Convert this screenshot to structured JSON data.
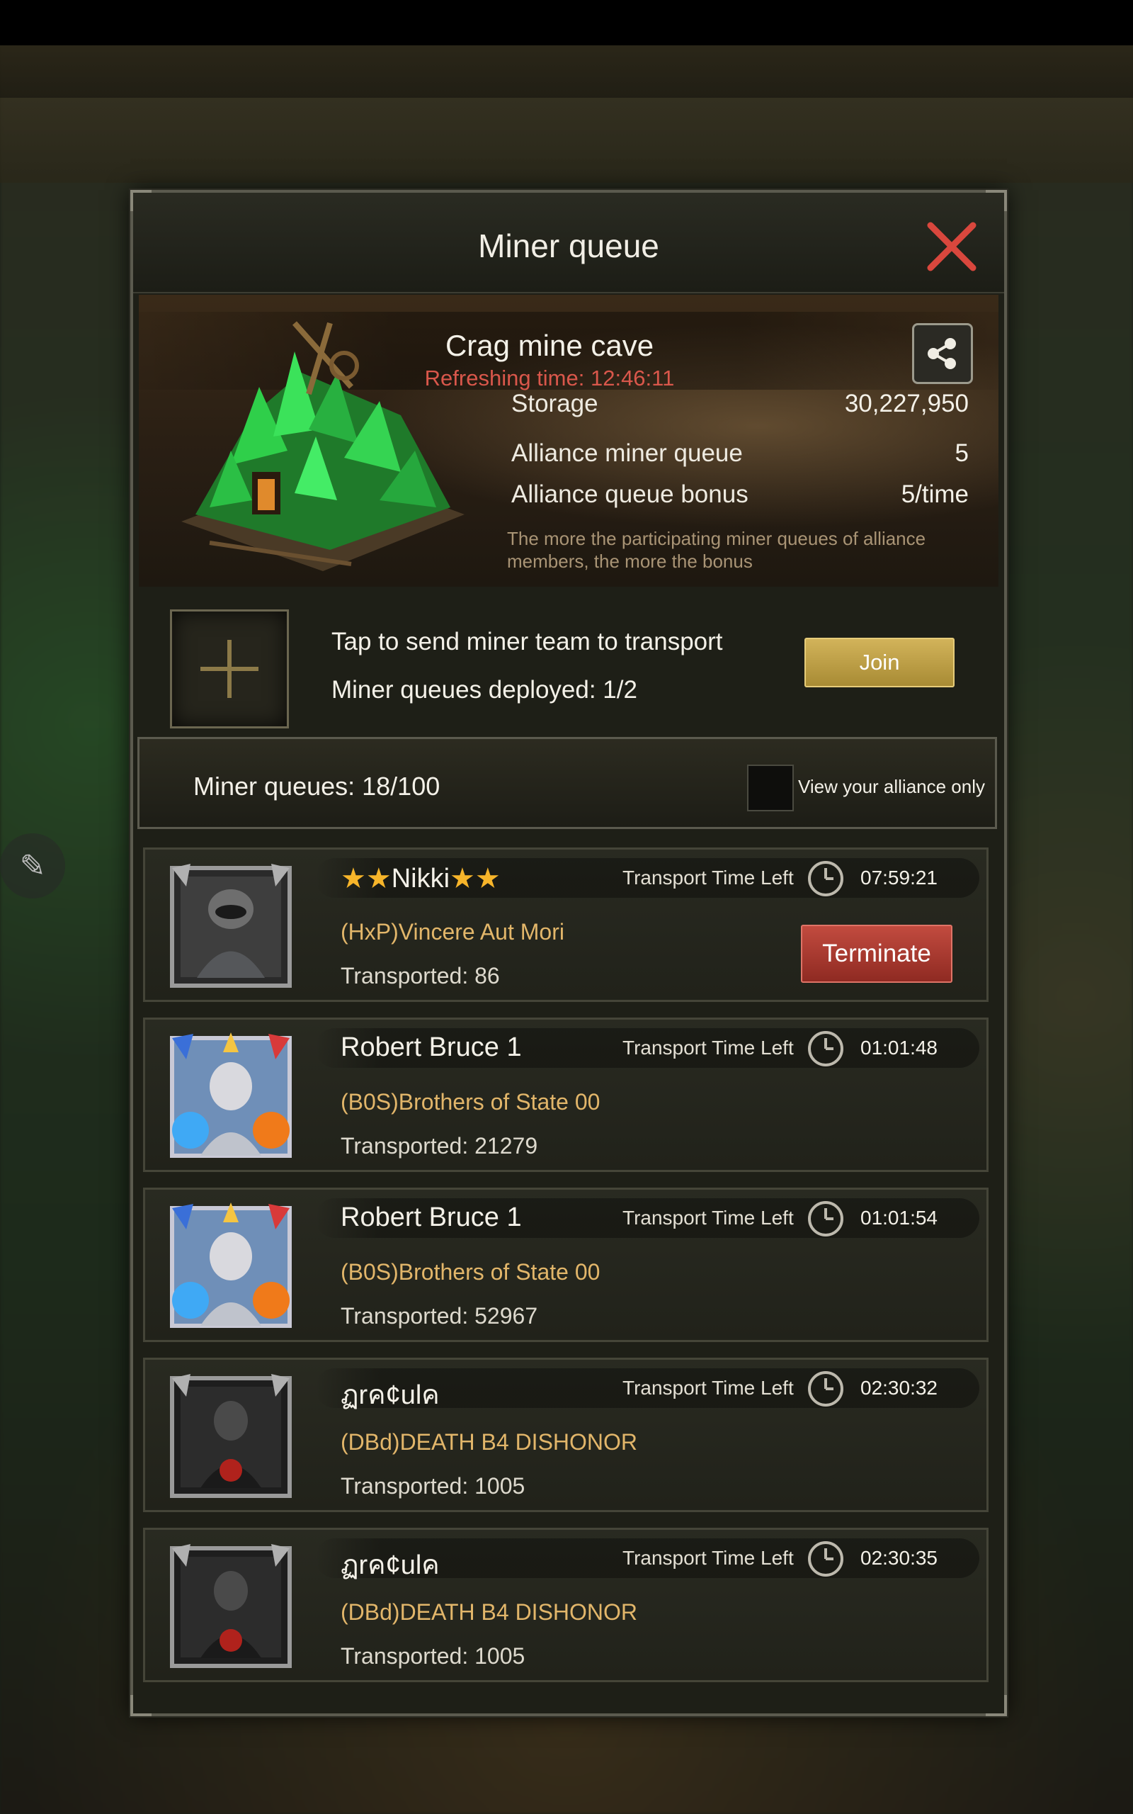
{
  "modal": {
    "title": "Miner queue"
  },
  "mine": {
    "name": "Crag mine cave",
    "refresh_label": "Refreshing time: 12:46:11",
    "stats": [
      {
        "label": "Storage",
        "value": "30,227,950"
      },
      {
        "label": "Alliance miner queue",
        "value": "5"
      },
      {
        "label": "Alliance queue bonus",
        "value": "5/time"
      }
    ],
    "note": "The more the participating miner queues of alliance members, the more the bonus"
  },
  "join": {
    "line1": "Tap to send miner team to transport",
    "line2": "Miner queues deployed: 1/2",
    "button": "Join"
  },
  "queues": {
    "count_label": "Miner queues: 18/100",
    "filter_label": "View your alliance only",
    "filter_checked": false
  },
  "rows": [
    {
      "name": "Nikki",
      "stars": true,
      "alliance": "(HxP)Vincere Aut Mori",
      "transported": "Transported: 86",
      "time_label": "Transport Time Left",
      "time": "07:59:21",
      "terminate": "Terminate",
      "avatar": "raccoon-knight"
    },
    {
      "name": "Robert Bruce 1",
      "stars": false,
      "alliance": "(B0S)Brothers of State 00",
      "transported": "Transported: 21279",
      "time_label": "Transport Time Left",
      "time": "01:01:48",
      "avatar": "stone-statue"
    },
    {
      "name": "Robert Bruce 1",
      "stars": false,
      "alliance": "(B0S)Brothers of State 00",
      "transported": "Transported: 52967",
      "time_label": "Transport Time Left",
      "time": "01:01:54",
      "avatar": "stone-statue"
    },
    {
      "name": "ฏrค¢ulค",
      "stars": false,
      "alliance": "(DBd)DEATH B4 DISHONOR",
      "transported": "Transported: 1005",
      "time_label": "Transport Time Left",
      "time": "02:30:32",
      "avatar": "dark-warrior"
    },
    {
      "name": "ฏrค¢ulค",
      "stars": false,
      "alliance": "(DBd)DEATH B4 DISHONOR",
      "transported": "Transported: 1005",
      "time_label": "Transport Time Left",
      "time": "02:30:35",
      "avatar": "dark-warrior"
    }
  ],
  "colors": {
    "accent_gold": "#d2b35a",
    "terminate_red": "#b83f34",
    "alliance_text": "#e2b66a",
    "refresh_red": "#d9574b",
    "star": "#f7b52a"
  }
}
